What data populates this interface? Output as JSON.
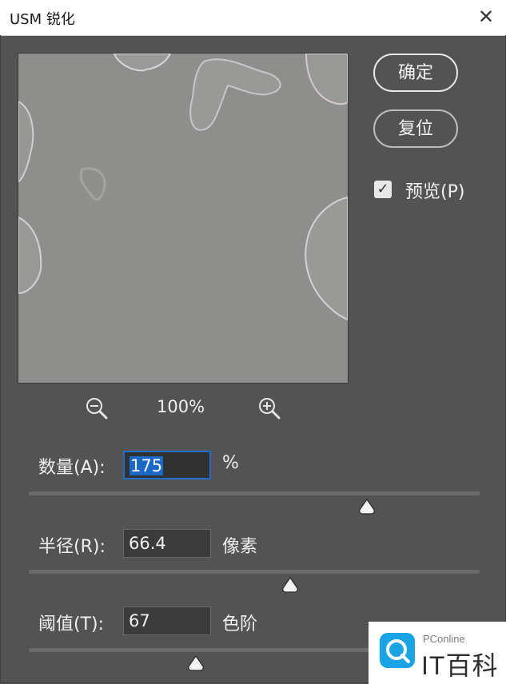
{
  "window": {
    "title": "USM 锐化",
    "close_glyph": "✕"
  },
  "buttons": {
    "ok_label": "确定",
    "reset_label": "复位"
  },
  "preview_toggle": {
    "label": "预览(P)",
    "checked": true
  },
  "zoom": {
    "level": "100%",
    "zoom_out_icon": "zoom-out-icon",
    "zoom_in_icon": "zoom-in-icon"
  },
  "controls": {
    "amount": {
      "label": "数量(A):",
      "value": "175",
      "unit": "%",
      "slider_fraction": 0.75
    },
    "radius": {
      "label": "半径(R):",
      "value": "66.4",
      "unit": "像素",
      "slider_fraction": 0.58
    },
    "threshold": {
      "label": "阈值(T):",
      "value": "67",
      "unit": "色阶",
      "slider_fraction": 0.37
    }
  },
  "watermark": {
    "small": "PConline",
    "big": "IT百科"
  },
  "colors": {
    "dialog_bg": "#535353",
    "preview_gray": "#8e8e8d",
    "selection_blue": "#1a68c8"
  }
}
